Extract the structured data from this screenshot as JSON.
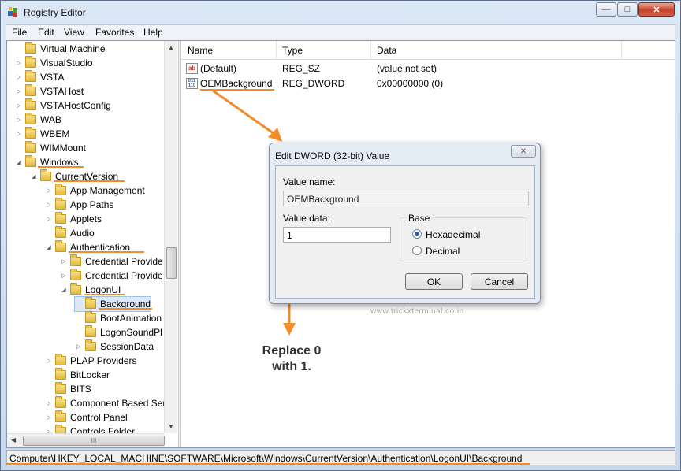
{
  "window": {
    "title": "Registry Editor",
    "minimize_glyph": "—",
    "maximize_glyph": "□",
    "close_glyph": "✕",
    "icon": "registry-editor-icon"
  },
  "menu": [
    "File",
    "Edit",
    "View",
    "Favorites",
    "Help"
  ],
  "tree": {
    "nodes": [
      {
        "label": "Virtual Machine"
      },
      {
        "label": "VisualStudio"
      },
      {
        "label": "VSTA"
      },
      {
        "label": "VSTAHost"
      },
      {
        "label": "VSTAHostConfig"
      },
      {
        "label": "WAB"
      },
      {
        "label": "WBEM"
      },
      {
        "label": "WIMMount"
      },
      {
        "label": "Windows"
      },
      {
        "label": "CurrentVersion"
      },
      {
        "label": "App Management"
      },
      {
        "label": "App Paths"
      },
      {
        "label": "Applets"
      },
      {
        "label": "Audio"
      },
      {
        "label": "Authentication"
      },
      {
        "label": "Credential Provide"
      },
      {
        "label": "Credential Provide"
      },
      {
        "label": "LogonUI"
      },
      {
        "label": "Background"
      },
      {
        "label": "BootAnimation"
      },
      {
        "label": "LogonSoundPl"
      },
      {
        "label": "SessionData"
      },
      {
        "label": "PLAP Providers"
      },
      {
        "label": "BitLocker"
      },
      {
        "label": "BITS"
      },
      {
        "label": "Component Based Ser"
      },
      {
        "label": "Control Panel"
      },
      {
        "label": "Controls Folder"
      }
    ],
    "hscroll_grip": "III"
  },
  "list": {
    "columns": [
      "Name",
      "Type",
      "Data"
    ],
    "rows": [
      {
        "icon_text": "ab",
        "icon": "string-value-icon",
        "name": "(Default)",
        "type": "REG_SZ",
        "data": "(value not set)"
      },
      {
        "icon_text": "011\n110",
        "icon": "binary-value-icon",
        "name": "OEMBackground",
        "type": "REG_DWORD",
        "data": "0x00000000 (0)"
      }
    ]
  },
  "status": {
    "path": "Computer\\HKEY_LOCAL_MACHINE\\SOFTWARE\\Microsoft\\Windows\\CurrentVersion\\Authentication\\LogonUI\\Background"
  },
  "dialog": {
    "title": "Edit DWORD (32-bit) Value",
    "close_glyph": "✕",
    "value_name_label": "Value name:",
    "value_name": "OEMBackground",
    "value_data_label": "Value data:",
    "value_data": "1",
    "base_label": "Base",
    "options": [
      "Hexadecimal",
      "Decimal"
    ],
    "selected_option": "Hexadecimal",
    "ok_label": "OK",
    "cancel_label": "Cancel"
  },
  "watermark": "www.trickxterminal.co.in",
  "annotation": {
    "line1": "Replace 0",
    "line2": "with 1."
  },
  "colors": {
    "annotation_orange": "#f28c28"
  }
}
